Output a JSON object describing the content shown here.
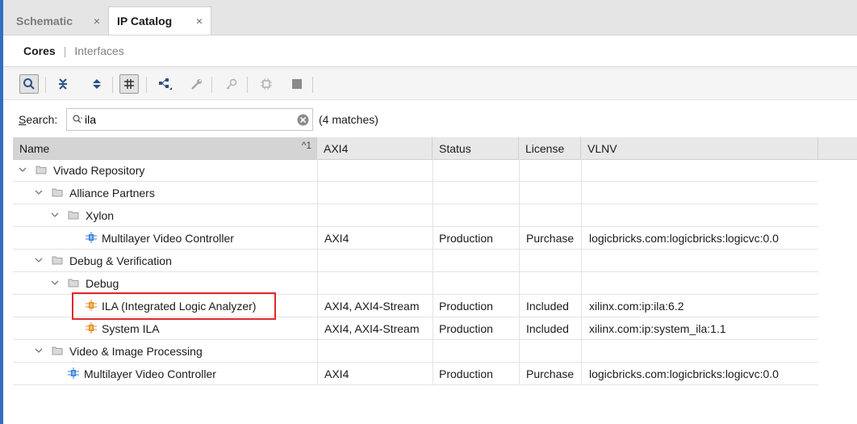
{
  "tabs": [
    {
      "label": "Schematic",
      "close": "×"
    },
    {
      "label": "IP Catalog",
      "close": "×"
    }
  ],
  "subtabs": {
    "active": "Cores",
    "separator": "|",
    "inactive": "Interfaces"
  },
  "toolbar": {
    "buttons": [
      "search-icon",
      "collapse-all-icon",
      "expand-all-icon",
      "flatten-hierarchy-icon",
      "hierarchy-icon",
      "wrench-icon",
      "key-icon",
      "chip-icon",
      "stop-icon"
    ]
  },
  "search": {
    "label_prefix": "S",
    "label_rest": "earch:",
    "value": "ila",
    "matches": "(4 matches)"
  },
  "columns": {
    "name": "Name",
    "sort_indicator": "^1",
    "axi4": "AXI4",
    "status": "Status",
    "license": "License",
    "vlnv": "VLNV"
  },
  "rows": [
    {
      "name": "Vivado Repository",
      "axi4": "",
      "status": "",
      "license": "",
      "vlnv": ""
    },
    {
      "name": "Alliance Partners",
      "axi4": "",
      "status": "",
      "license": "",
      "vlnv": ""
    },
    {
      "name": "Xylon",
      "axi4": "",
      "status": "",
      "license": "",
      "vlnv": ""
    },
    {
      "name": "Multilayer Video Controller",
      "axi4": "AXI4",
      "status": "Production",
      "license": "Purchase",
      "vlnv": "logicbricks.com:logicbricks:logicvc:0.0"
    },
    {
      "name": "Debug & Verification",
      "axi4": "",
      "status": "",
      "license": "",
      "vlnv": ""
    },
    {
      "name": "Debug",
      "axi4": "",
      "status": "",
      "license": "",
      "vlnv": ""
    },
    {
      "name": "ILA (Integrated Logic Analyzer)",
      "axi4": "AXI4, AXI4-Stream",
      "status": "Production",
      "license": "Included",
      "vlnv": "xilinx.com:ip:ila:6.2"
    },
    {
      "name": "System ILA",
      "axi4": "AXI4, AXI4-Stream",
      "status": "Production",
      "license": "Included",
      "vlnv": "xilinx.com:ip:system_ila:1.1"
    },
    {
      "name": "Video & Image Processing",
      "axi4": "",
      "status": "",
      "license": "",
      "vlnv": ""
    },
    {
      "name": "Multilayer Video Controller",
      "axi4": "AXI4",
      "status": "Production",
      "license": "Purchase",
      "vlnv": "logicbricks.com:logicbricks:logicvc:0.0"
    }
  ],
  "colors": {
    "accent": "#2f6fc6",
    "highlight_box": "#e0282b"
  }
}
